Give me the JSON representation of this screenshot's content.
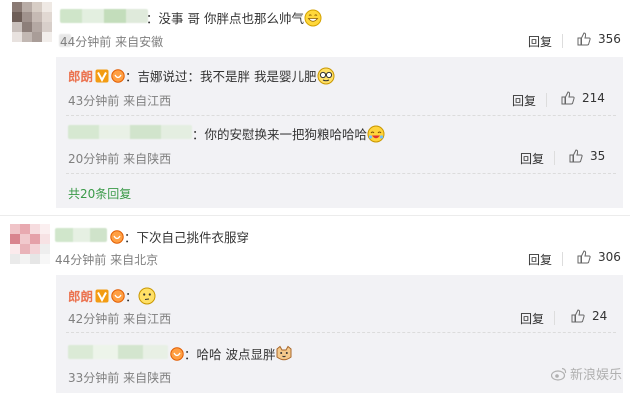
{
  "comments": [
    {
      "text": "：没事 哥 你胖点也那么帅气",
      "meta": "44分钟前 来自安徽",
      "reply": "回复",
      "likes": "356",
      "subs": [
        {
          "name": "郎朗",
          "text": "：吉娜说过：我不是胖 我是婴儿肥",
          "meta": "43分钟前 来自江西",
          "reply": "回复",
          "likes": "214"
        },
        {
          "name": "",
          "text": "：你的安慰换来一把狗粮哈哈哈",
          "meta": "20分钟前 来自陕西",
          "reply": "回复",
          "likes": "35"
        }
      ],
      "more": "共20条回复"
    },
    {
      "text": "：下次自己挑件衣服穿",
      "meta": "44分钟前 来自北京",
      "reply": "回复",
      "likes": "306",
      "subs": [
        {
          "name": "郎朗",
          "text": "：",
          "meta": "42分钟前 来自江西",
          "reply": "回复",
          "likes": "24"
        },
        {
          "name": "",
          "text": "：哈哈 波点显胖",
          "meta": "33分钟前 来自陕西",
          "reply": "回复",
          "likes": "25"
        }
      ]
    }
  ],
  "watermark": "新浪娱乐",
  "icons": {
    "like": "thumbs-up-icon",
    "verified": "verified-v-icon",
    "emoji": "smile-emoji-icon",
    "watermark": "weibo-logo-icon"
  },
  "colors": {
    "name": "#eb7350",
    "more": "#3a9a48",
    "meta": "#808080"
  }
}
